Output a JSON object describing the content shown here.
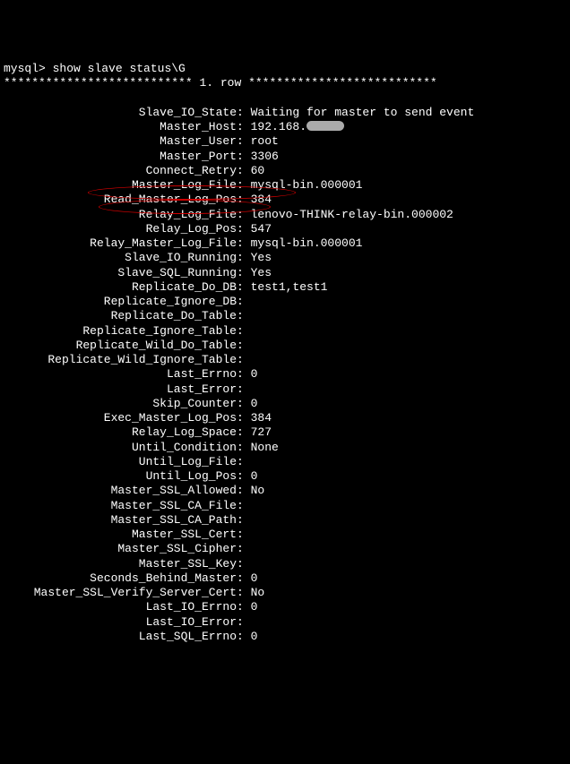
{
  "prompt": {
    "label": "mysql>",
    "command": "show slave status\\G"
  },
  "row_separator_left": "***************************",
  "row_label": "1. row",
  "row_separator_right": "***************************",
  "fields": [
    {
      "label": "Slave_IO_State",
      "value": "Waiting for master to send event"
    },
    {
      "label": "Master_Host",
      "value": "192.168.",
      "redacted": true
    },
    {
      "label": "Master_User",
      "value": "root"
    },
    {
      "label": "Master_Port",
      "value": "3306"
    },
    {
      "label": "Connect_Retry",
      "value": "60"
    },
    {
      "label": "Master_Log_File",
      "value": "mysql-bin.000001"
    },
    {
      "label": "Read_Master_Log_Pos",
      "value": "384"
    },
    {
      "label": "Relay_Log_File",
      "value": "lenovo-THINK-relay-bin.000002"
    },
    {
      "label": "Relay_Log_Pos",
      "value": "547"
    },
    {
      "label": "Relay_Master_Log_File",
      "value": "mysql-bin.000001"
    },
    {
      "label": "Slave_IO_Running",
      "value": "Yes",
      "highlighted": true
    },
    {
      "label": "Slave_SQL_Running",
      "value": "Yes",
      "highlighted": true
    },
    {
      "label": "Replicate_Do_DB",
      "value": "test1,test1"
    },
    {
      "label": "Replicate_Ignore_DB",
      "value": ""
    },
    {
      "label": "Replicate_Do_Table",
      "value": ""
    },
    {
      "label": "Replicate_Ignore_Table",
      "value": ""
    },
    {
      "label": "Replicate_Wild_Do_Table",
      "value": ""
    },
    {
      "label": "Replicate_Wild_Ignore_Table",
      "value": ""
    },
    {
      "label": "Last_Errno",
      "value": "0"
    },
    {
      "label": "Last_Error",
      "value": ""
    },
    {
      "label": "Skip_Counter",
      "value": "0"
    },
    {
      "label": "Exec_Master_Log_Pos",
      "value": "384"
    },
    {
      "label": "Relay_Log_Space",
      "value": "727"
    },
    {
      "label": "Until_Condition",
      "value": "None"
    },
    {
      "label": "Until_Log_File",
      "value": ""
    },
    {
      "label": "Until_Log_Pos",
      "value": "0"
    },
    {
      "label": "Master_SSL_Allowed",
      "value": "No"
    },
    {
      "label": "Master_SSL_CA_File",
      "value": ""
    },
    {
      "label": "Master_SSL_CA_Path",
      "value": ""
    },
    {
      "label": "Master_SSL_Cert",
      "value": ""
    },
    {
      "label": "Master_SSL_Cipher",
      "value": ""
    },
    {
      "label": "Master_SSL_Key",
      "value": ""
    },
    {
      "label": "Seconds_Behind_Master",
      "value": "0"
    },
    {
      "label": "Master_SSL_Verify_Server_Cert",
      "value": "No"
    },
    {
      "label": "Last_IO_Errno",
      "value": "0"
    },
    {
      "label": "Last_IO_Error",
      "value": ""
    },
    {
      "label": "Last_SQL_Errno",
      "value": "0"
    }
  ]
}
